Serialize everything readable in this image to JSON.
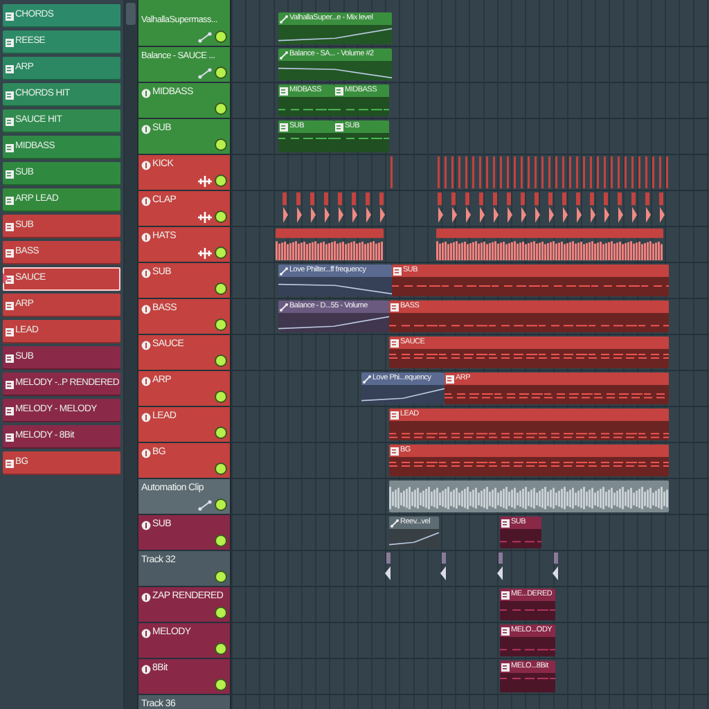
{
  "patterns": [
    {
      "label": "CHORDS",
      "color": "#2c8a6a",
      "selected": false
    },
    {
      "label": "REESE",
      "color": "#2d8a66",
      "selected": false
    },
    {
      "label": "ARP",
      "color": "#2b8862",
      "selected": false
    },
    {
      "label": "CHORDS HIT",
      "color": "#2e8a5c",
      "selected": false
    },
    {
      "label": "SAUCE HIT",
      "color": "#318b50",
      "selected": false
    },
    {
      "label": "MIDBASS",
      "color": "#2f8a46",
      "selected": false
    },
    {
      "label": "SUB",
      "color": "#2f8a40",
      "selected": false
    },
    {
      "label": "ARP LEAD",
      "color": "#338a3c",
      "selected": false
    },
    {
      "label": "SUB",
      "color": "#c0403f",
      "selected": false
    },
    {
      "label": "BASS",
      "color": "#c0403f",
      "selected": false
    },
    {
      "label": "SAUCE",
      "color": "#c0403f",
      "selected": true
    },
    {
      "label": "ARP",
      "color": "#c0403f",
      "selected": false
    },
    {
      "label": "LEAD",
      "color": "#c0403f",
      "selected": false
    },
    {
      "label": "SUB",
      "color": "#8a2a48",
      "selected": false
    },
    {
      "label": "MELODY -..P RENDERED",
      "color": "#8a2a48",
      "selected": false
    },
    {
      "label": "MELODY - MELODY",
      "color": "#8a2a48",
      "selected": false
    },
    {
      "label": "MELODY - 8Bit",
      "color": "#8a2a48",
      "selected": false
    },
    {
      "label": "BG",
      "color": "#c0403f",
      "selected": false
    }
  ],
  "tracks": [
    {
      "kind": "automation",
      "name": "ValhallaSupermass...",
      "color": "#3a8f3e",
      "enabled": true,
      "clips": [
        {
          "kind": "automation",
          "label": "ValhallaSuper...e - Mix level",
          "color": "#3a8f3e"
        }
      ]
    },
    {
      "kind": "automation",
      "name": "Balance - SAUCE ...",
      "color": "#3a8f3e",
      "enabled": true,
      "clips": [
        {
          "kind": "automation",
          "label": "Balance - SA... - Volume #2",
          "color": "#3a8f3e"
        }
      ]
    },
    {
      "kind": "instrument",
      "name": "MIDBASS",
      "color": "#3a8f3e",
      "enabled": true,
      "clips": [
        {
          "kind": "pattern",
          "label": "MIDBASS",
          "color": "#3a8f3e"
        },
        {
          "kind": "pattern",
          "label": "MIDBASS",
          "color": "#3a8f3e"
        }
      ]
    },
    {
      "kind": "instrument",
      "name": "SUB",
      "color": "#3a8f3e",
      "enabled": true,
      "clips": [
        {
          "kind": "pattern",
          "label": "SUB",
          "color": "#3a8f3e"
        },
        {
          "kind": "pattern",
          "label": "SUB",
          "color": "#3a8f3e"
        }
      ]
    },
    {
      "kind": "drum",
      "name": "KICK",
      "color": "#c4423f",
      "enabled": true,
      "clips": [
        {
          "kind": "hits",
          "color": "#c4423f"
        },
        {
          "kind": "hits",
          "color": "#c4423f"
        }
      ]
    },
    {
      "kind": "drum",
      "name": "CLAP",
      "color": "#c4423f",
      "enabled": true,
      "clips": [
        {
          "kind": "hits",
          "color": "#c4423f"
        },
        {
          "kind": "hits",
          "color": "#c4423f"
        }
      ]
    },
    {
      "kind": "drum",
      "name": "HATS",
      "color": "#c4423f",
      "enabled": true,
      "clips": [
        {
          "kind": "audio",
          "color": "#c4423f"
        },
        {
          "kind": "audio",
          "color": "#c4423f"
        }
      ]
    },
    {
      "kind": "instrument",
      "name": "SUB",
      "color": "#c4423f",
      "enabled": true,
      "clips": [
        {
          "kind": "automation",
          "label": "Love Philter...ff frequency",
          "color": "#5a6a90"
        },
        {
          "kind": "pattern",
          "label": "SUB",
          "color": "#c4423f"
        }
      ]
    },
    {
      "kind": "instrument",
      "name": "BASS",
      "color": "#c4423f",
      "enabled": true,
      "clips": [
        {
          "kind": "automation",
          "label": "Balance - D...55 - Volume",
          "color": "#6a5a80"
        },
        {
          "kind": "pattern",
          "label": "BASS",
          "color": "#c4423f"
        }
      ]
    },
    {
      "kind": "instrument",
      "name": "SAUCE",
      "color": "#c4423f",
      "enabled": true,
      "clips": [
        {
          "kind": "pattern",
          "label": "SAUCE",
          "color": "#c4423f"
        }
      ]
    },
    {
      "kind": "instrument",
      "name": "ARP",
      "color": "#c4423f",
      "enabled": true,
      "clips": [
        {
          "kind": "automation",
          "label": "Love Phi...equency",
          "color": "#5a6a90"
        },
        {
          "kind": "pattern",
          "label": "ARP",
          "color": "#c4423f"
        }
      ]
    },
    {
      "kind": "instrument",
      "name": "LEAD",
      "color": "#c4423f",
      "enabled": true,
      "clips": [
        {
          "kind": "pattern",
          "label": "LEAD",
          "color": "#c4423f"
        }
      ]
    },
    {
      "kind": "instrument",
      "name": "BG",
      "color": "#c4423f",
      "enabled": true,
      "clips": [
        {
          "kind": "pattern",
          "label": "BG",
          "color": "#c4423f"
        }
      ]
    },
    {
      "kind": "automation",
      "name": "Automation Clip",
      "color": "#5d6b73",
      "enabled": true,
      "clips": [
        {
          "kind": "audio",
          "color": "#7d8a90"
        }
      ]
    },
    {
      "kind": "instrument",
      "name": "SUB",
      "color": "#8a2848",
      "enabled": true,
      "clips": [
        {
          "kind": "automation",
          "label": "Reev...vel",
          "color": "#5d6b73"
        },
        {
          "kind": "pattern",
          "label": "SUB",
          "color": "#8a2848"
        }
      ]
    },
    {
      "kind": "track",
      "name": "Track 32",
      "color": "#4d5c64",
      "enabled": true,
      "clips": [
        {
          "kind": "marker",
          "color": "#8a7a9a"
        },
        {
          "kind": "marker",
          "color": "#8a7a9a"
        },
        {
          "kind": "marker",
          "color": "#8a7a9a"
        },
        {
          "kind": "marker",
          "color": "#8a7a9a"
        }
      ]
    },
    {
      "kind": "instrument",
      "name": "ZAP RENDERED",
      "color": "#8a2848",
      "enabled": true,
      "clips": [
        {
          "kind": "pattern",
          "label": "ME...DERED",
          "color": "#8a2848"
        }
      ]
    },
    {
      "kind": "instrument",
      "name": "MELODY",
      "color": "#8a2848",
      "enabled": true,
      "clips": [
        {
          "kind": "pattern",
          "label": "MELO...ODY",
          "color": "#8a2848"
        }
      ]
    },
    {
      "kind": "instrument",
      "name": "8Bit",
      "color": "#8a2848",
      "enabled": true,
      "clips": [
        {
          "kind": "pattern",
          "label": "MELO...8Bit",
          "color": "#8a2848"
        }
      ]
    },
    {
      "kind": "track",
      "name": "Track 36",
      "color": "#4d5c64"
    }
  ]
}
